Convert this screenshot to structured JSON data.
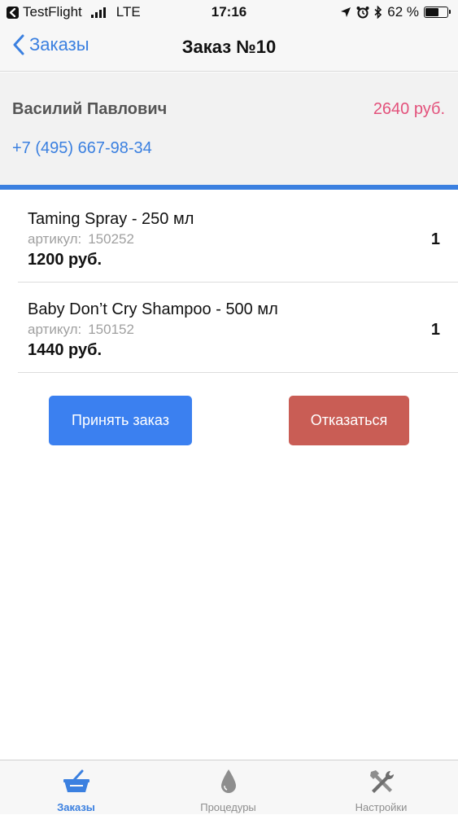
{
  "status_bar": {
    "app": "TestFlight",
    "carrier": "LTE",
    "time": "17:16",
    "battery": "62 %",
    "battery_level": 0.62
  },
  "nav": {
    "back_label": "Заказы",
    "title": "Заказ №10"
  },
  "customer": {
    "name": "Василий Павлович",
    "total": "2640 руб.",
    "phone": "+7 (495) 667-98-34"
  },
  "items": [
    {
      "name": "Taming Spray - 250 мл",
      "sku_label": "артикул:",
      "sku": "150252",
      "price": "1200 руб.",
      "qty": "1"
    },
    {
      "name": "Baby Don’t Cry Shampoo - 500 мл",
      "sku_label": "артикул:",
      "sku": "150152",
      "price": "1440 руб.",
      "qty": "1"
    }
  ],
  "actions": {
    "accept": "Принять заказ",
    "decline": "Отказаться"
  },
  "tabs": [
    {
      "label": "Заказы",
      "icon": "basket-icon",
      "active": true
    },
    {
      "label": "Процедуры",
      "icon": "drop-icon",
      "active": false
    },
    {
      "label": "Настройки",
      "icon": "tools-icon",
      "active": false
    }
  ],
  "colors": {
    "accent": "#3b80e0",
    "total": "#e3517b",
    "accept_button": "#3b80f0",
    "decline_button": "#c95d55"
  }
}
